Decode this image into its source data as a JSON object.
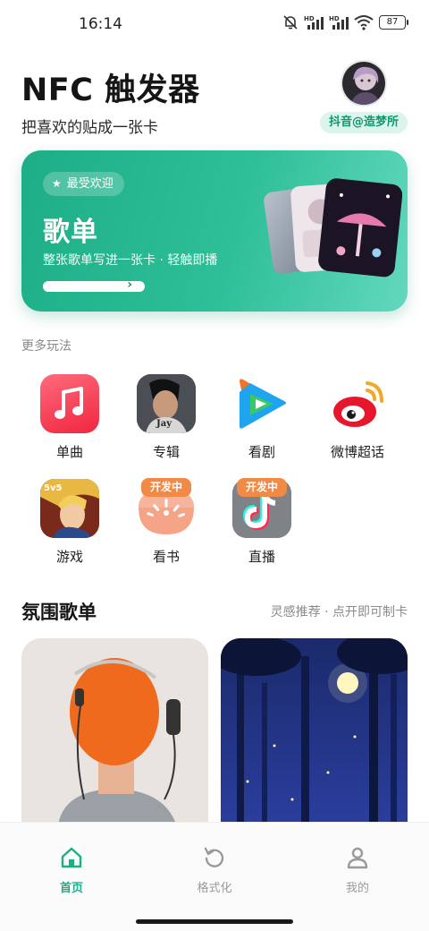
{
  "status_bar": {
    "time": "16:14",
    "battery": "87",
    "icons": [
      "mute-bell-icon",
      "hd-signal-icon",
      "hd-signal-icon",
      "wifi-icon",
      "battery-icon"
    ]
  },
  "header": {
    "title": "NFC 触发器",
    "subtitle": "把喜欢的贴成一张卡",
    "author_badge": "抖音@造梦所"
  },
  "hero": {
    "badge": "最受欢迎",
    "badge_icon": "star-icon",
    "title": "歌单",
    "description": "整张歌单写进一张卡 · 轻触即播",
    "progress": 1.0
  },
  "more": {
    "label": "更多玩法",
    "items": [
      {
        "label": "单曲",
        "icon": "music-note-icon",
        "badge": ""
      },
      {
        "label": "专辑",
        "icon": "album-cover-icon",
        "badge": ""
      },
      {
        "label": "看剧",
        "icon": "video-play-icon",
        "badge": ""
      },
      {
        "label": "微博超话",
        "icon": "weibo-icon",
        "badge": ""
      },
      {
        "label": "游戏",
        "icon": "game-icon",
        "badge": ""
      },
      {
        "label": "看书",
        "icon": "book-icon",
        "badge": "开发中"
      },
      {
        "label": "直播",
        "icon": "douyin-icon",
        "badge": "开发中"
      }
    ]
  },
  "playlists": {
    "title": "氛围歌单",
    "hint": "灵感推荐 · 点开即可制卡"
  },
  "nav": {
    "items": [
      {
        "label": "首页",
        "icon": "home-icon",
        "active": true
      },
      {
        "label": "格式化",
        "icon": "refresh-icon",
        "active": false
      },
      {
        "label": "我的",
        "icon": "user-icon",
        "active": false
      }
    ]
  },
  "colors": {
    "accent": "#1eae87",
    "badge_orange": "#f08a46",
    "inactive": "#9a9a9a"
  }
}
